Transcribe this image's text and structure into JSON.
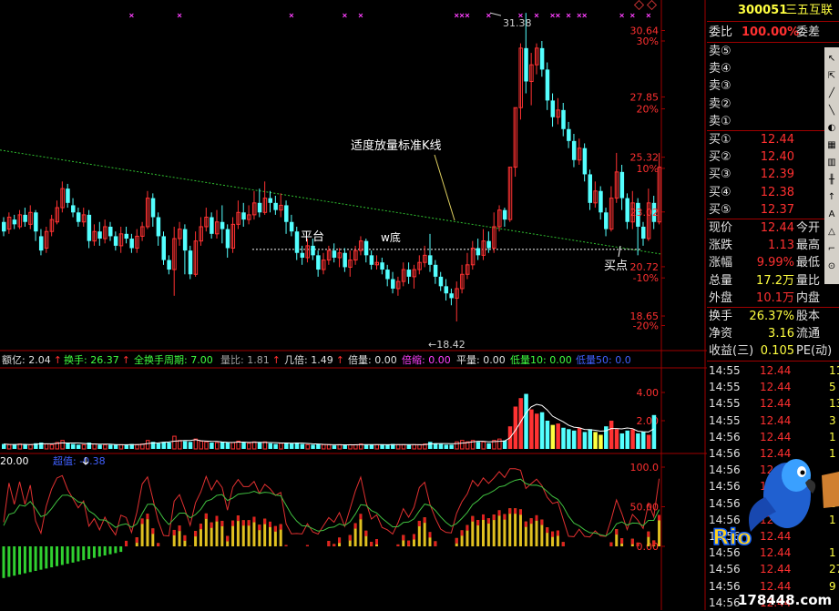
{
  "chart_data": {
    "type": "candlestick",
    "price_axis": {
      "ticks": [
        {
          "label": "30.64",
          "v": 30.64
        },
        {
          "label": "30%",
          "v": 30.2
        },
        {
          "label": "27.85",
          "v": 27.85
        },
        {
          "label": "20%",
          "v": 27.35
        },
        {
          "label": "25.32",
          "v": 25.32
        },
        {
          "label": "10%",
          "v": 24.85
        },
        {
          "label": "23.02",
          "v": 23.02
        },
        {
          "label": "20.72",
          "v": 20.72
        },
        {
          "label": "-10%",
          "v": 20.25
        },
        {
          "label": "18.65",
          "v": 18.65
        },
        {
          "label": "-20%",
          "v": 18.25
        }
      ]
    },
    "candles": [
      [
        22.6,
        22.2,
        22.8,
        22.0
      ],
      [
        22.3,
        22.8,
        23.0,
        22.1
      ],
      [
        22.7,
        22.5,
        22.9,
        22.3
      ],
      [
        22.4,
        22.9,
        23.1,
        22.3
      ],
      [
        22.9,
        22.6,
        23.2,
        22.4
      ],
      [
        22.5,
        23.0,
        23.3,
        22.3
      ],
      [
        23.0,
        22.2,
        23.1,
        21.8
      ],
      [
        22.0,
        21.4,
        22.3,
        21.2
      ],
      [
        21.5,
        22.2,
        22.4,
        21.3
      ],
      [
        22.2,
        22.7,
        22.9,
        22.0
      ],
      [
        22.6,
        23.2,
        23.5,
        22.5
      ],
      [
        23.2,
        24.0,
        24.3,
        23.0
      ],
      [
        24.0,
        23.4,
        24.2,
        23.2
      ],
      [
        23.3,
        23.0,
        23.6,
        22.8
      ],
      [
        23.0,
        22.6,
        23.2,
        22.4
      ],
      [
        22.6,
        22.9,
        23.2,
        22.4
      ],
      [
        22.9,
        21.8,
        23.1,
        21.5
      ],
      [
        21.8,
        22.2,
        22.5,
        21.6
      ],
      [
        22.2,
        21.9,
        22.6,
        21.6
      ],
      [
        21.9,
        22.4,
        22.7,
        21.7
      ],
      [
        22.4,
        22.0,
        22.6,
        21.8
      ],
      [
        22.0,
        21.6,
        22.2,
        21.4
      ],
      [
        21.6,
        22.1,
        22.4,
        21.3
      ],
      [
        22.1,
        21.9,
        22.4,
        21.7
      ],
      [
        21.9,
        21.5,
        22.1,
        21.3
      ],
      [
        21.5,
        22.0,
        22.3,
        21.3
      ],
      [
        22.0,
        22.4,
        22.6,
        21.8
      ],
      [
        22.4,
        23.6,
        23.9,
        22.3
      ],
      [
        23.6,
        22.8,
        23.8,
        22.4
      ],
      [
        22.8,
        22.0,
        23.0,
        21.6
      ],
      [
        22.0,
        21.0,
        22.2,
        20.8
      ],
      [
        21.0,
        20.6,
        21.2,
        20.4
      ],
      [
        20.6,
        21.9,
        22.4,
        19.5
      ],
      [
        21.9,
        22.3,
        22.6,
        21.6
      ],
      [
        22.3,
        21.4,
        22.5,
        20.4
      ],
      [
        21.4,
        20.4,
        21.6,
        20.2
      ],
      [
        20.4,
        21.8,
        22.2,
        20.3
      ],
      [
        21.8,
        22.4,
        22.8,
        21.6
      ],
      [
        22.4,
        22.8,
        23.2,
        22.2
      ],
      [
        22.8,
        22.1,
        23.0,
        21.9
      ],
      [
        22.1,
        22.6,
        23.1,
        21.9
      ],
      [
        22.6,
        22.3,
        23.3,
        21.7
      ],
      [
        22.3,
        21.5,
        22.5,
        21.1
      ],
      [
        21.5,
        22.5,
        22.8,
        21.3
      ],
      [
        22.5,
        23.0,
        23.5,
        22.3
      ],
      [
        23.0,
        22.7,
        23.4,
        22.4
      ],
      [
        22.7,
        22.9,
        23.3,
        22.5
      ],
      [
        22.9,
        23.4,
        23.9,
        22.7
      ],
      [
        23.4,
        23.0,
        24.0,
        22.8
      ],
      [
        23.0,
        23.6,
        24.3,
        22.9
      ],
      [
        23.6,
        23.4,
        23.9,
        23.0
      ],
      [
        23.4,
        23.1,
        23.7,
        22.9
      ],
      [
        23.1,
        23.3,
        23.8,
        22.8
      ],
      [
        23.3,
        22.6,
        23.5,
        22.1
      ],
      [
        22.6,
        22.2,
        22.9,
        22.0
      ],
      [
        22.2,
        21.3,
        22.4,
        21.0
      ],
      [
        21.3,
        21.1,
        21.6,
        20.8
      ],
      [
        21.1,
        21.6,
        21.9,
        20.9
      ],
      [
        21.6,
        21.2,
        21.9,
        21.0
      ],
      [
        21.2,
        20.6,
        21.4,
        20.3
      ],
      [
        20.6,
        21.0,
        21.3,
        20.4
      ],
      [
        21.0,
        21.4,
        21.6,
        20.8
      ],
      [
        21.4,
        21.1,
        21.7,
        20.9
      ],
      [
        21.1,
        21.3,
        21.5,
        20.7
      ],
      [
        21.3,
        20.7,
        21.5,
        20.5
      ],
      [
        20.7,
        21.0,
        21.4,
        20.3
      ],
      [
        21.0,
        21.4,
        21.6,
        20.8
      ],
      [
        21.4,
        21.8,
        22.0,
        21.2
      ],
      [
        21.8,
        21.2,
        21.9,
        20.9
      ],
      [
        21.2,
        20.8,
        21.4,
        20.6
      ],
      [
        20.8,
        20.9,
        21.2,
        20.6
      ],
      [
        20.9,
        20.6,
        21.1,
        20.4
      ],
      [
        20.6,
        20.2,
        20.8,
        19.9
      ],
      [
        20.2,
        19.8,
        20.5,
        19.6
      ],
      [
        19.8,
        20.1,
        20.3,
        19.5
      ],
      [
        20.1,
        20.6,
        20.9,
        19.9
      ],
      [
        20.6,
        20.3,
        20.9,
        20.0
      ],
      [
        20.3,
        20.6,
        20.8,
        19.8
      ],
      [
        20.6,
        20.9,
        21.2,
        20.4
      ],
      [
        20.9,
        21.2,
        21.6,
        20.7
      ],
      [
        21.2,
        20.8,
        22.1,
        20.5
      ],
      [
        20.8,
        20.3,
        21.0,
        20.0
      ],
      [
        20.3,
        19.9,
        20.5,
        19.7
      ],
      [
        19.9,
        19.6,
        20.2,
        19.3
      ],
      [
        19.6,
        19.4,
        19.8,
        19.1
      ],
      [
        19.4,
        19.8,
        20.1,
        18.42
      ],
      [
        19.8,
        20.4,
        20.8,
        19.6
      ],
      [
        20.4,
        20.8,
        21.3,
        20.2
      ],
      [
        20.8,
        21.5,
        21.8,
        20.6
      ],
      [
        21.5,
        21.2,
        21.9,
        21.0
      ],
      [
        21.2,
        21.8,
        22.3,
        21.0
      ],
      [
        21.8,
        21.5,
        22.2,
        21.3
      ],
      [
        21.5,
        22.4,
        23.0,
        21.3
      ],
      [
        22.4,
        23.1,
        23.3,
        22.2
      ],
      [
        23.1,
        22.7,
        23.2,
        22.4
      ],
      [
        22.7,
        24.9,
        24.9,
        22.6
      ],
      [
        24.9,
        27.4,
        27.4,
        24.5
      ],
      [
        27.4,
        29.9,
        30.1,
        26.9
      ],
      [
        29.9,
        28.5,
        31.38,
        28.0
      ],
      [
        28.5,
        29.2,
        29.7,
        27.5
      ],
      [
        29.2,
        29.9,
        30.1,
        28.8
      ],
      [
        29.9,
        29.0,
        30.2,
        28.7
      ],
      [
        29.0,
        27.7,
        29.3,
        27.3
      ],
      [
        27.7,
        27.0,
        28.0,
        26.6
      ],
      [
        27.0,
        27.3,
        27.8,
        26.7
      ],
      [
        27.3,
        26.5,
        27.6,
        26.2
      ],
      [
        26.5,
        26.0,
        26.8,
        25.7
      ],
      [
        26.0,
        25.2,
        26.3,
        24.9
      ],
      [
        25.2,
        25.7,
        26.1,
        25.0
      ],
      [
        25.7,
        24.6,
        25.9,
        24.3
      ],
      [
        24.6,
        23.4,
        24.8,
        23.1
      ],
      [
        23.4,
        23.9,
        24.3,
        23.2
      ],
      [
        23.9,
        23.0,
        24.1,
        22.7
      ],
      [
        23.0,
        22.3,
        23.2,
        22.0
      ],
      [
        22.3,
        23.6,
        24.1,
        22.2
      ],
      [
        23.6,
        24.7,
        25.5,
        23.4
      ],
      [
        24.7,
        23.6,
        25.0,
        23.1
      ],
      [
        23.6,
        22.6,
        23.8,
        22.3
      ],
      [
        22.6,
        23.4,
        23.9,
        22.3
      ],
      [
        23.4,
        22.4,
        23.6,
        21.2
      ],
      [
        22.4,
        21.9,
        22.6,
        21.6
      ],
      [
        21.9,
        23.4,
        24.0,
        21.8
      ],
      [
        23.4,
        22.6,
        23.7,
        22.3
      ],
      [
        22.6,
        24.9,
        25.5,
        22.5
      ]
    ],
    "annotations": {
      "high": "31.38",
      "low": "18.42",
      "support": "平台",
      "w_bottom": "w底",
      "volume_note": "适度放量标准K线",
      "buy_point": "买点"
    },
    "indicator_strip": [
      {
        "label": "额亿: 2.04",
        "color": "#e0e0e0",
        "arrow": true
      },
      {
        "label": "换手: 26.37",
        "color": "#40ff40",
        "arrow": true
      },
      {
        "label": "全换手周期: 7.00",
        "color": "#40ff40",
        "arrow": false
      },
      {
        "label": "量比: 1.81",
        "color": "#a0a0a0",
        "arrow": true
      },
      {
        "label": "几倍: 1.49",
        "color": "#e0e0e0",
        "arrow": true
      },
      {
        "label": "倍量: 0.00",
        "color": "#e0e0e0",
        "arrow": false
      },
      {
        "label": "倍缩: 0.00",
        "color": "#ff40ff",
        "arrow": false
      },
      {
        "label": "平量: 0.00",
        "color": "#e0e0e0",
        "arrow": false
      },
      {
        "label": "低量10: 0.00",
        "color": "#40ff40",
        "arrow": false
      },
      {
        "label": "低量50: 0.0",
        "color": "#4060ff",
        "arrow": false
      }
    ],
    "volume_axis": [
      {
        "label": "4.00",
        "v": 4.0
      },
      {
        "label": "2.00",
        "v": 2.0
      }
    ],
    "volume_values": [
      0.35,
      0.3,
      0.3,
      0.35,
      0.3,
      0.3,
      0.4,
      0.45,
      0.35,
      0.3,
      0.45,
      0.6,
      0.4,
      0.35,
      0.3,
      0.3,
      0.45,
      0.35,
      0.3,
      0.3,
      0.3,
      0.3,
      0.3,
      0.3,
      0.35,
      0.3,
      0.35,
      0.6,
      0.5,
      0.4,
      0.5,
      0.45,
      0.9,
      0.6,
      0.55,
      0.5,
      0.7,
      0.55,
      0.5,
      0.45,
      0.45,
      0.5,
      0.45,
      0.45,
      0.55,
      0.45,
      0.4,
      0.5,
      0.45,
      0.5,
      0.4,
      0.35,
      0.4,
      0.45,
      0.4,
      0.45,
      0.35,
      0.3,
      0.3,
      0.35,
      0.3,
      0.3,
      0.25,
      0.3,
      0.3,
      0.3,
      0.3,
      0.35,
      0.3,
      0.3,
      0.3,
      0.3,
      0.3,
      0.35,
      0.3,
      0.3,
      0.3,
      0.3,
      0.3,
      0.35,
      0.5,
      0.4,
      0.35,
      0.3,
      0.3,
      0.5,
      0.6,
      0.5,
      0.6,
      0.5,
      0.5,
      0.4,
      0.6,
      0.7,
      0.6,
      1.6,
      3.0,
      3.6,
      3.9,
      2.8,
      2.5,
      2.6,
      2.0,
      1.7,
      1.8,
      1.5,
      1.4,
      1.3,
      1.5,
      1.2,
      1.4,
      1.2,
      1.0,
      1.6,
      2.0,
      1.4,
      1.1,
      1.3,
      1.4,
      1.1,
      1.2,
      1.0,
      2.4
    ],
    "oscillator": {
      "label_value": "20.00",
      "label_name": "超值: -0.38",
      "axis": [
        {
          "label": "100.0",
          "v": 100
        },
        {
          "label": "50.00",
          "v": 50
        },
        {
          "label": "0.00",
          "v": 0
        }
      ]
    },
    "grid": false
  },
  "quote": {
    "code": "300051",
    "name": "三五互联",
    "ratio_label": "委比",
    "ratio_value": "100.00%",
    "diff_label": "委差",
    "asks": [
      {
        "label": "卖⑤"
      },
      {
        "label": "卖④"
      },
      {
        "label": "卖③"
      },
      {
        "label": "卖②"
      },
      {
        "label": "卖①"
      }
    ],
    "bids": [
      {
        "label": "买①",
        "price": "12.44"
      },
      {
        "label": "买②",
        "price": "12.40"
      },
      {
        "label": "买③",
        "price": "12.39"
      },
      {
        "label": "买④",
        "price": "12.38"
      },
      {
        "label": "买⑤",
        "price": "12.37"
      }
    ],
    "stats": [
      {
        "label": "现价",
        "value": "12.44",
        "value_color": "#ff3030",
        "label2": "今开"
      },
      {
        "label": "涨跌",
        "value": "1.13",
        "value_color": "#ff3030",
        "label2": "最高"
      },
      {
        "label": "涨幅",
        "value": "9.99%",
        "value_color": "#ff3030",
        "label2": "最低"
      },
      {
        "label": "总量",
        "value": "17.2万",
        "value_color": "#ffff40",
        "label2": "量比"
      },
      {
        "label": "外盘",
        "value": "10.1万",
        "value_color": "#ff3030",
        "label2": "内盘"
      }
    ],
    "stats2": [
      {
        "label": "换手",
        "value": "26.37%",
        "value_color": "#ffff40",
        "label2": "股本"
      },
      {
        "label": "净资",
        "value": "3.16",
        "value_color": "#ffff40",
        "label2": "流通"
      },
      {
        "label": "收益(三)",
        "value": "0.105",
        "value_color": "#ffff40",
        "label2": "PE(动)"
      }
    ],
    "ticks": [
      {
        "time": "14:55",
        "price": "12.44",
        "vol": "11"
      },
      {
        "time": "14:55",
        "price": "12.44",
        "vol": "5"
      },
      {
        "time": "14:55",
        "price": "12.44",
        "vol": "13"
      },
      {
        "time": "14:55",
        "price": "12.44",
        "vol": "3"
      },
      {
        "time": "14:56",
        "price": "12.44",
        "vol": "1"
      },
      {
        "time": "14:56",
        "price": "12.44",
        "vol": "1"
      },
      {
        "time": "14:56",
        "price": "12.44",
        "vol": ""
      },
      {
        "time": "14:56",
        "price": "12.44",
        "vol": "1"
      },
      {
        "time": "14:56",
        "price": "12.44",
        "vol": "2"
      },
      {
        "time": "14:56",
        "price": "12.44",
        "vol": "1"
      },
      {
        "time": "14:56",
        "price": "12.44",
        "vol": ""
      },
      {
        "time": "14:56",
        "price": "12.44",
        "vol": "1"
      },
      {
        "time": "14:56",
        "price": "12.44",
        "vol": "27"
      },
      {
        "time": "14:56",
        "price": "12.44",
        "vol": "9"
      },
      {
        "time": "14:56",
        "price": "12.44",
        "vol": ""
      }
    ],
    "watermark": "178448.com"
  },
  "colors": {
    "up": "#ff3232",
    "down": "#54ffff",
    "axis": "#a00000",
    "trend": "#30c030"
  }
}
